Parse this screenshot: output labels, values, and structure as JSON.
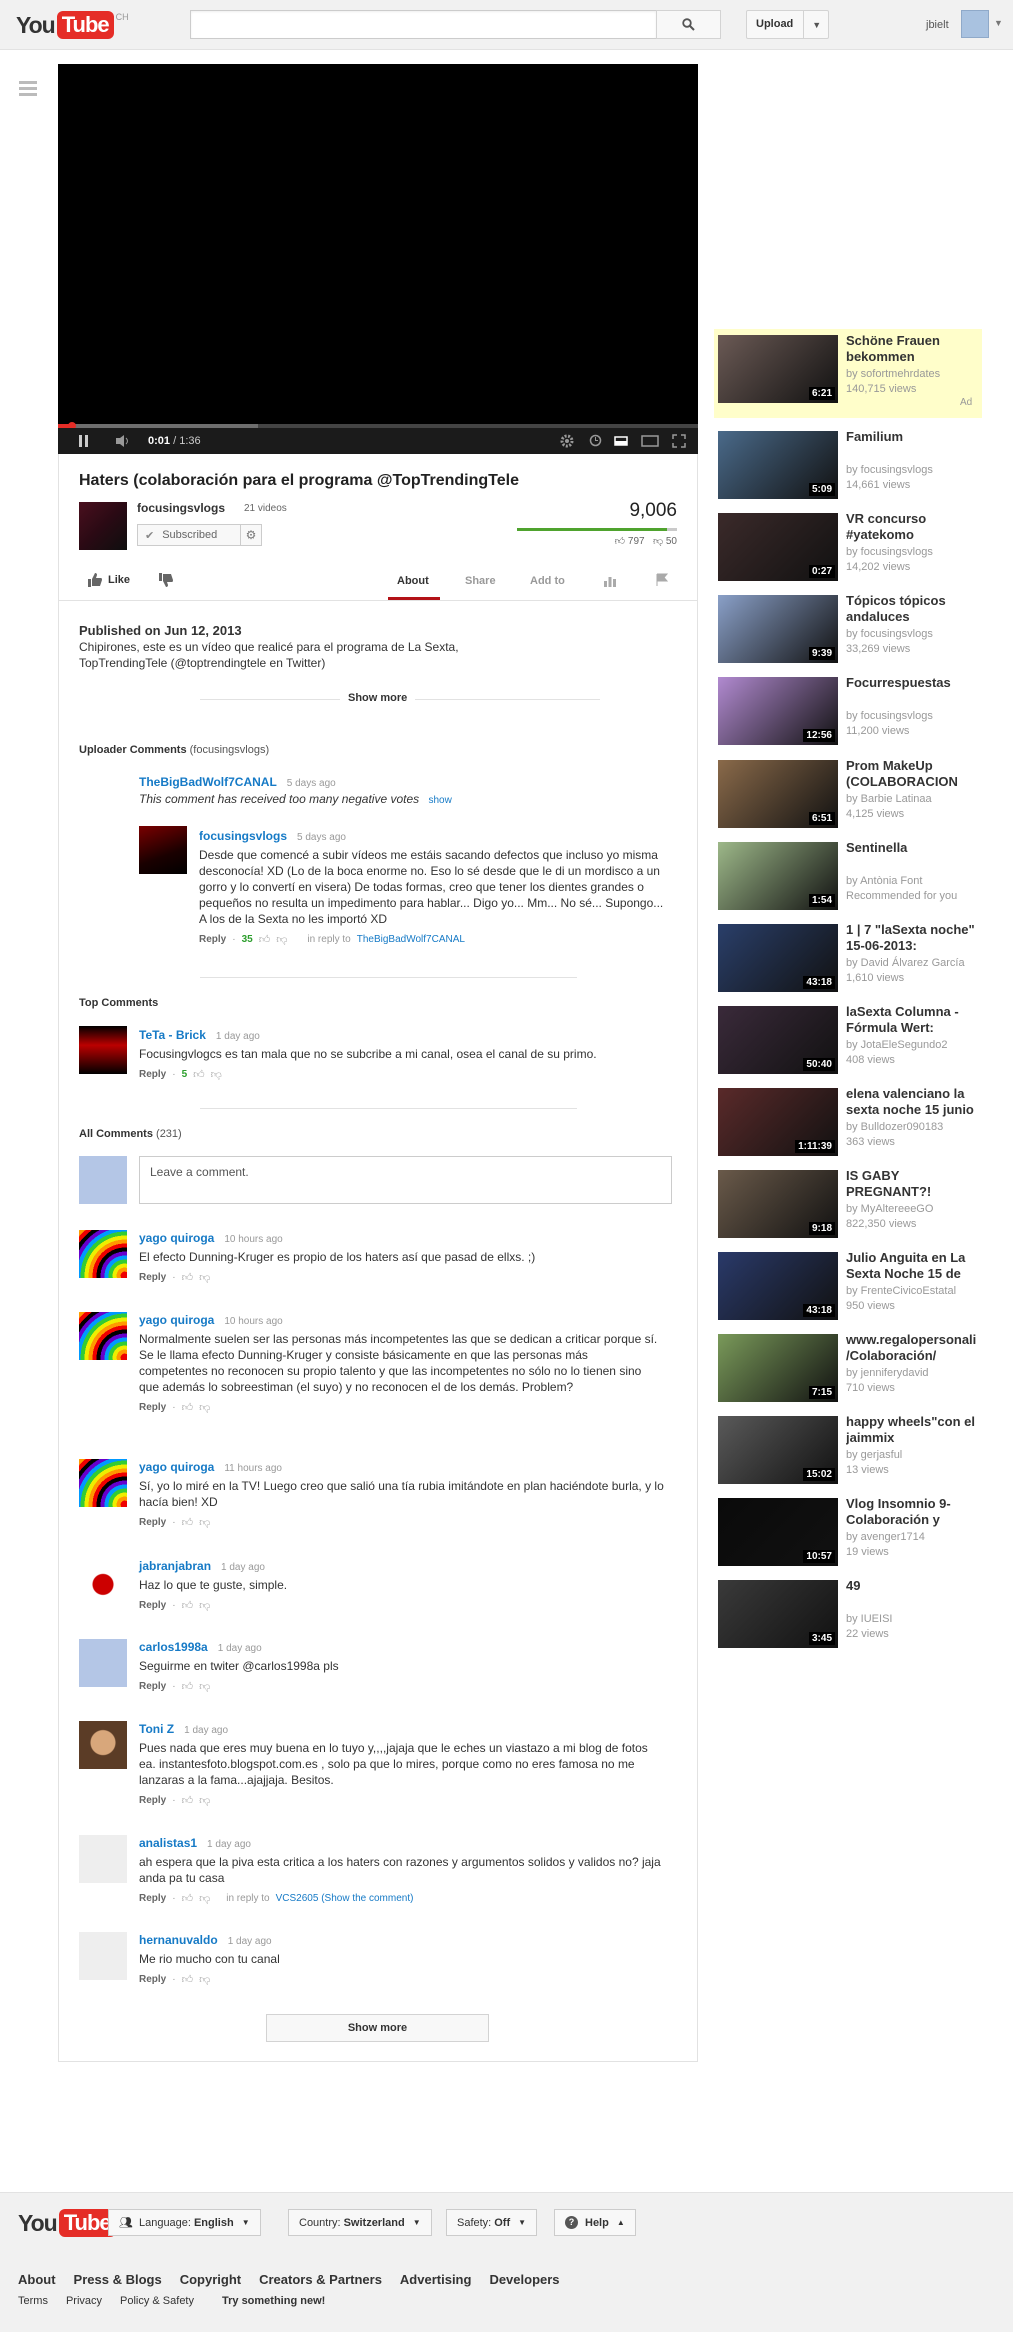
{
  "masthead": {
    "logo_you": "You",
    "logo_tube": "Tube",
    "logo_country": "CH",
    "search_placeholder": "",
    "upload_label": "Upload",
    "user_name": "jbielt"
  },
  "player": {
    "current_time": "0:01",
    "duration": "1:36",
    "progress_fraction": 0.01
  },
  "video": {
    "title": "Haters (colaboración para el programa @TopTrendingTele",
    "channel_name": "focusingsvlogs",
    "channel_videos": "21 videos",
    "subscribed_label": "Subscribed",
    "view_count": "9,006",
    "likes": "797",
    "dislikes": "50",
    "like_ratio": 0.94,
    "like_label": "Like",
    "tabs": [
      "About",
      "Share",
      "Add to"
    ],
    "published": "Published on Jun 12, 2013",
    "description": "Chipirones, este es un vídeo que realicé para el programa de La Sexta, TopTrendingTele (@toptrendingtele en Twitter)",
    "show_more": "Show more"
  },
  "uploader_comments": {
    "heading": "Uploader Comments",
    "heading_sub": "(focusingsvlogs)",
    "items": [
      {
        "author": "TheBigBadWolf7CANAL",
        "time": "5 days ago",
        "text": "This comment has received too many negative votes",
        "show": "show"
      },
      {
        "author": "focusingsvlogs",
        "time": "5 days ago",
        "text": "Desde que comencé a subir vídeos me estáis sacando defectos que incluso yo misma desconocía! XD (Lo de la boca enorme no. Eso lo sé desde que le di un mordisco a un gorro y lo convertí en visera) De todas formas, creo que tener los dientes grandes o pequeños no resulta un impedimento para hablar... Digo yo... Mm... No sé... Supongo... A los de la Sexta no les importó XD",
        "votes": "35",
        "in_reply_to": "in reply to",
        "reply_target": "TheBigBadWolf7CANAL"
      }
    ]
  },
  "top_comments": {
    "heading": "Top Comments",
    "items": [
      {
        "author": "TeTa - Brick",
        "time": "1 day ago",
        "text": "Focusingvlogcs es tan mala que no se subcribe a mi canal, osea el canal de su primo.",
        "votes": "5"
      }
    ]
  },
  "all_comments": {
    "heading": "All Comments",
    "count": "(231)",
    "input_placeholder": "Leave a comment.",
    "items": [
      {
        "author": "yago quiroga",
        "time": "10 hours ago",
        "text": "El efecto Dunning-Kruger es propio de los haters así que pasad de ellxs. ;)"
      },
      {
        "author": "yago quiroga",
        "time": "10 hours ago",
        "text": "Normalmente suelen ser las personas más incompetentes las que se dedican a criticar porque sí. Se le llama efecto Dunning-Kruger y consiste básicamente en que las personas más competentes no reconocen su propio talento y que las incompetentes no sólo no lo tienen sino que además lo sobreestiman (el suyo) y no reconocen el de los demás. Problem?"
      },
      {
        "author": "yago quiroga",
        "time": "11 hours ago",
        "text": "Sí, yo lo miré en la TV! Luego creo que salió una tía rubia imitándote en plan haciéndote burla, y lo hacía bien! XD"
      },
      {
        "author": "jabranjabran",
        "time": "1 day ago",
        "text": "Haz lo que te guste, simple."
      },
      {
        "author": "carlos1998a",
        "time": "1 day ago",
        "text": "Seguirme en twiter @carlos1998a pls"
      },
      {
        "author": "Toni Z",
        "time": "1 day ago",
        "text": "Pues nada que eres muy buena en lo tuyo y,,,,jajaja que le eches un viastazo a mi blog de fotos ea. instantesfoto.blogspot.com.es , solo pa que lo mires, porque como no eres famosa no me lanzaras a la fama...ajajjaja. Besitos."
      },
      {
        "author": "analistas1",
        "time": "1 day ago",
        "text": "ah espera que la piva esta critica a los haters con razones y argumentos solidos y validos no? jaja anda pa tu casa",
        "in_reply_to": "in reply to",
        "reply_target": "VCS2605 (Show the comment)"
      },
      {
        "author": "hernanuvaldo",
        "time": "1 day ago",
        "text": "Me rio mucho con tu canal"
      }
    ],
    "reply_label": "Reply",
    "show_more": "Show more"
  },
  "sidebar": {
    "ad_label": "Ad",
    "videos": [
      {
        "title": "Schöne Frauen bekommen",
        "by": "by sofortmehrdates",
        "views": "140,715 views",
        "duration": "6:21",
        "color": "#6b5a55"
      },
      {
        "title": "Familium",
        "by": "by focusingsvlogs",
        "views": "14,661 views",
        "duration": "5:09",
        "color": "#4a6a8a"
      },
      {
        "title": "VR concurso #yatekomo",
        "by": "by focusingsvlogs",
        "views": "14,202 views",
        "duration": "0:27",
        "color": "#3b2a2a"
      },
      {
        "title": "Tópicos tópicos andaluces",
        "by": "by focusingsvlogs",
        "views": "33,269 views",
        "duration": "9:39",
        "color": "#8aa0c8"
      },
      {
        "title": "Focurrespuestas",
        "by": "by focusingsvlogs",
        "views": "11,200 views",
        "duration": "12:56",
        "color": "#b18ad0"
      },
      {
        "title": "Prom MakeUp (COLABORACION",
        "by": "by Barbie Latinaa",
        "views": "4,125 views",
        "duration": "6:51",
        "color": "#8a6a4a"
      },
      {
        "title": "Sentinella",
        "by": "by Antònia Font",
        "views": "Recommended for you",
        "duration": "1:54",
        "color": "#9db889"
      },
      {
        "title": "1 | 7 \"laSexta noche\" 15-06-2013:",
        "by": "by David Álvarez García",
        "views": "1,610 views",
        "duration": "43:18",
        "color": "#2a3f6a"
      },
      {
        "title": "laSexta Columna - Fórmula Wert:",
        "by": "by JotaEleSegundo2",
        "views": "408 views",
        "duration": "50:40",
        "color": "#3a2a3a"
      },
      {
        "title": "elena valenciano la sexta noche 15 junio",
        "by": "by Bulldozer090183",
        "views": "363 views",
        "duration": "1:11:39",
        "color": "#5a2a2a"
      },
      {
        "title": "IS GABY PREGNANT?!",
        "by": "by MyAltereeeGO",
        "views": "822,350 views",
        "duration": "9:18",
        "color": "#6a5a4a"
      },
      {
        "title": "Julio Anguita en La Sexta Noche 15 de",
        "by": "by FrenteCivicoEstatal",
        "views": "950 views",
        "duration": "43:18",
        "color": "#2a3a6a"
      },
      {
        "title": "www.regalopersonali /Colaboración/",
        "by": "by jenniferydavid",
        "views": "710 views",
        "duration": "7:15",
        "color": "#7a9a5a"
      },
      {
        "title": "happy wheels\"con el jaimmix",
        "by": "by gerjasful",
        "views": "13 views",
        "duration": "15:02",
        "color": "#5a5a5a"
      },
      {
        "title": "Vlog Insomnio 9- Colaboración y",
        "by": "by avenger1714",
        "views": "19 views",
        "duration": "10:57",
        "color": "#0a0a0a"
      },
      {
        "title": "49",
        "by": "by IUEISI",
        "views": "22 views",
        "duration": "3:45",
        "color": "#3a3a3a"
      }
    ]
  },
  "footer": {
    "language_label": "Language:",
    "language_value": "English",
    "country_label": "Country:",
    "country_value": "Switzerland",
    "safety_label": "Safety:",
    "safety_value": "Off",
    "help_label": "Help",
    "links1": [
      "About",
      "Press & Blogs",
      "Copyright",
      "Creators & Partners",
      "Advertising",
      "Developers"
    ],
    "links2": [
      "Terms",
      "Privacy",
      "Policy & Safety"
    ],
    "try_label": "Try something new!"
  }
}
